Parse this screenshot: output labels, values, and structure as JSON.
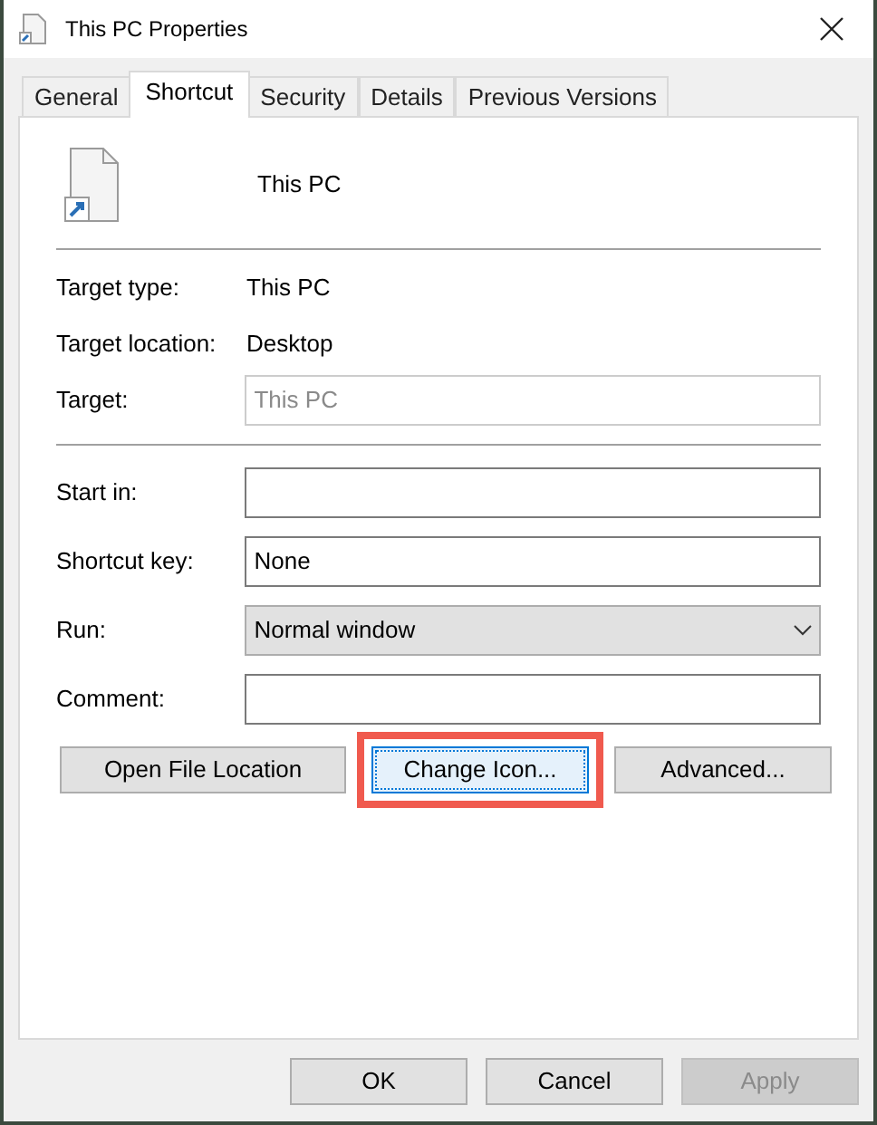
{
  "window": {
    "title": "This PC Properties"
  },
  "tabs": [
    {
      "label": "General",
      "selected": false
    },
    {
      "label": "Shortcut",
      "selected": true
    },
    {
      "label": "Security",
      "selected": false
    },
    {
      "label": "Details",
      "selected": false
    },
    {
      "label": "Previous Versions",
      "selected": false
    }
  ],
  "shortcut": {
    "name": "This PC"
  },
  "info": [
    {
      "label": "Target type:",
      "value": "This PC"
    },
    {
      "label": "Target location:",
      "value": "Desktop"
    }
  ],
  "target": {
    "label": "Target:",
    "value": "This PC",
    "disabled": true
  },
  "fields": [
    {
      "kind": "text",
      "label": "Start in:"
    },
    {
      "kind": "text",
      "label": "Shortcut key:",
      "value": "None"
    },
    {
      "kind": "select",
      "label": "Run:",
      "value": "Normal window"
    },
    {
      "kind": "text",
      "label": "Comment:"
    }
  ],
  "actions": [
    {
      "label": "Open File Location",
      "focused": false,
      "highlighted": false
    },
    {
      "label": "Change Icon...",
      "focused": true,
      "highlighted": true
    },
    {
      "label": "Advanced...",
      "focused": false,
      "highlighted": false
    }
  ],
  "footer": [
    {
      "label": "OK",
      "disabled": false
    },
    {
      "label": "Cancel",
      "disabled": false
    },
    {
      "label": "Apply",
      "disabled": true
    }
  ]
}
